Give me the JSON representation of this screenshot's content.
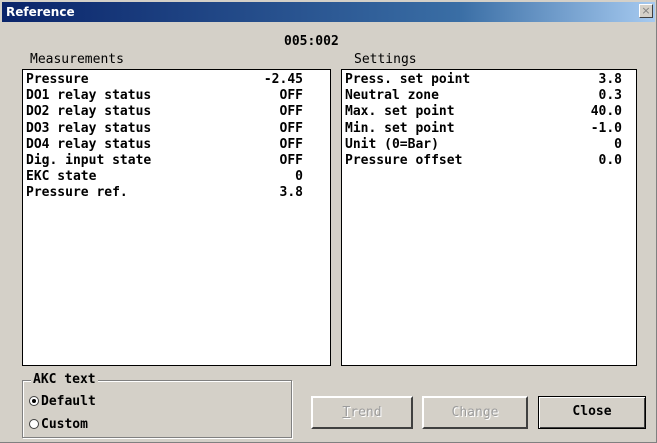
{
  "window": {
    "title": "Reference",
    "close_glyph": "×"
  },
  "header": {
    "address": "005:002"
  },
  "measurements": {
    "heading": "Measurements",
    "rows": [
      {
        "label": "Pressure",
        "value": "-2.45"
      },
      {
        "label": "DO1 relay status",
        "value": "OFF"
      },
      {
        "label": "DO2 relay status",
        "value": "OFF"
      },
      {
        "label": "DO3 relay status",
        "value": "OFF"
      },
      {
        "label": "DO4 relay status",
        "value": "OFF"
      },
      {
        "label": "Dig. input state",
        "value": "OFF"
      },
      {
        "label": "EKC state",
        "value": "0"
      },
      {
        "label": "Pressure ref.",
        "value": "3.8"
      }
    ]
  },
  "settings": {
    "heading": "Settings",
    "rows": [
      {
        "label": "Press. set point",
        "value": "3.8"
      },
      {
        "label": "Neutral zone",
        "value": "0.3"
      },
      {
        "label": "Max. set point",
        "value": "40.0"
      },
      {
        "label": "Min. set point",
        "value": "-1.0"
      },
      {
        "label": "Unit (0=Bar)",
        "value": "0"
      },
      {
        "label": "Pressure offset",
        "value": "0.0"
      }
    ]
  },
  "akc_text": {
    "legend": "AKC text",
    "options": [
      {
        "label": "Default",
        "selected": true
      },
      {
        "label": "Custom",
        "selected": false
      }
    ]
  },
  "buttons": {
    "trend_first": "T",
    "trend_rest": "rend",
    "change": "Change",
    "close": "Close"
  }
}
